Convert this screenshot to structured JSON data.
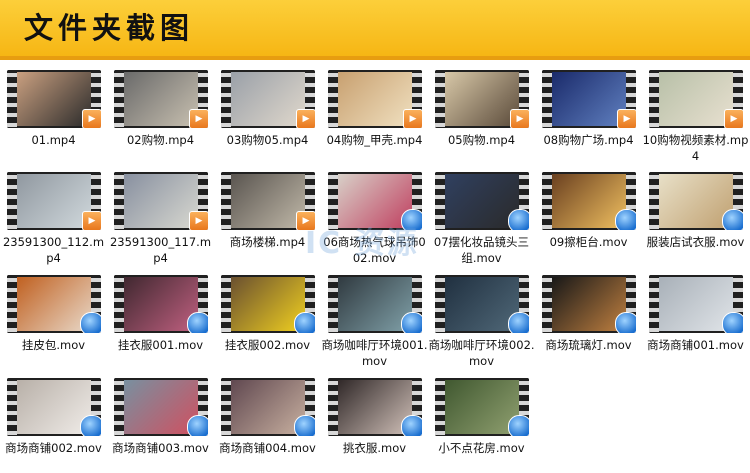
{
  "header": {
    "title": "文件夹截图"
  },
  "watermark": "IC 资源",
  "files": [
    {
      "label": "01.mp4",
      "type": "mp4",
      "icon": "video-thumbnail-mango-store",
      "palette": [
        "#caa080",
        "#2b2b2b"
      ]
    },
    {
      "label": "02购物.mp4",
      "type": "mp4",
      "icon": "video-thumbnail-shopping",
      "palette": [
        "#6a6a6a",
        "#c8c0b0"
      ]
    },
    {
      "label": "03购物05.mp4",
      "type": "mp4",
      "icon": "video-thumbnail-shopping",
      "palette": [
        "#9aa0a8",
        "#e0d8cc"
      ]
    },
    {
      "label": "04购物_甲壳.mp4",
      "type": "mp4",
      "icon": "video-thumbnail-mall",
      "palette": [
        "#c8a070",
        "#f0e0c0"
      ]
    },
    {
      "label": "05购物.mp4",
      "type": "mp4",
      "icon": "video-thumbnail-shopping",
      "palette": [
        "#d8c8a8",
        "#5a4a3a"
      ]
    },
    {
      "label": "08购物广场.mp4",
      "type": "mp4",
      "icon": "video-thumbnail-plaza",
      "palette": [
        "#1a2a6a",
        "#6080c0"
      ]
    },
    {
      "label": "10购物视频素材.mp4",
      "type": "mp4",
      "icon": "video-thumbnail-mall",
      "palette": [
        "#b8c0a8",
        "#e8e0d0"
      ]
    },
    {
      "label": "23591300_112.mp4",
      "type": "mp4",
      "icon": "video-thumbnail-atrium",
      "palette": [
        "#9098a0",
        "#d0d8dc"
      ]
    },
    {
      "label": "23591300_117.mp4",
      "type": "mp4",
      "icon": "video-thumbnail-atrium",
      "palette": [
        "#8890a0",
        "#d8d8d0"
      ]
    },
    {
      "label": "商场楼梯.mp4",
      "type": "mp4",
      "icon": "video-thumbnail-stairs",
      "palette": [
        "#5a5550",
        "#c0b8a8"
      ]
    },
    {
      "label": "06商场热气球吊饰002.mov",
      "type": "mov",
      "icon": "video-thumbnail-balloons",
      "palette": [
        "#d8d0c8",
        "#c04060"
      ]
    },
    {
      "label": "07摆化妆品镜头三组.mov",
      "type": "mov",
      "icon": "video-thumbnail-cosmetics",
      "palette": [
        "#304060",
        "#2a2a2a"
      ]
    },
    {
      "label": "09擦柜台.mov",
      "type": "mov",
      "icon": "video-thumbnail-counter",
      "palette": [
        "#6a4020",
        "#f0c060"
      ]
    },
    {
      "label": "服装店试衣服.mov",
      "type": "mov",
      "icon": "video-thumbnail-clothing",
      "palette": [
        "#e8e0c8",
        "#c0a070"
      ]
    },
    {
      "label": "挂皮包.mov",
      "type": "mov",
      "icon": "video-thumbnail-handbag",
      "palette": [
        "#c06020",
        "#e8d8c8"
      ]
    },
    {
      "label": "挂衣服001.mov",
      "type": "mov",
      "icon": "video-thumbnail-clothes",
      "palette": [
        "#402830",
        "#c06080"
      ]
    },
    {
      "label": "挂衣服002.mov",
      "type": "mov",
      "icon": "video-thumbnail-clothes",
      "palette": [
        "#6a5030",
        "#f0d020"
      ]
    },
    {
      "label": "商场咖啡厅环境001.mov",
      "type": "mov",
      "icon": "video-thumbnail-cafe",
      "palette": [
        "#303a40",
        "#80a0a8"
      ]
    },
    {
      "label": "商场咖啡厅环境002.mov",
      "type": "mov",
      "icon": "video-thumbnail-cafe",
      "palette": [
        "#203040",
        "#506878"
      ]
    },
    {
      "label": "商场琉璃灯.mov",
      "type": "mov",
      "icon": "video-thumbnail-lamp",
      "palette": [
        "#181818",
        "#c08040"
      ]
    },
    {
      "label": "商场商铺001.mov",
      "type": "mov",
      "icon": "video-thumbnail-shop",
      "palette": [
        "#a8b0b8",
        "#e0e4e8"
      ]
    },
    {
      "label": "商场商铺002.mov",
      "type": "mov",
      "icon": "video-thumbnail-shop",
      "palette": [
        "#b8b0a8",
        "#f0ece8"
      ]
    },
    {
      "label": "商场商铺003.mov",
      "type": "mov",
      "icon": "video-thumbnail-shop",
      "palette": [
        "#7890a0",
        "#d05060"
      ]
    },
    {
      "label": "商场商铺004.mov",
      "type": "mov",
      "icon": "video-thumbnail-shop",
      "palette": [
        "#604850",
        "#c8b0a0"
      ]
    },
    {
      "label": "挑衣服.mov",
      "type": "mov",
      "icon": "video-thumbnail-clothes",
      "palette": [
        "#302828",
        "#d0c0b8"
      ]
    },
    {
      "label": "小不点花房.mov",
      "type": "mov",
      "icon": "video-thumbnail-flowers",
      "palette": [
        "#405830",
        "#90a070"
      ]
    }
  ]
}
